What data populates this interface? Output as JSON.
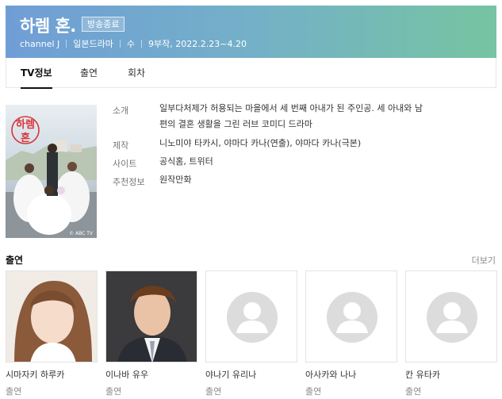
{
  "header": {
    "title": "하렘 혼.",
    "badge": "방송종료",
    "meta": [
      "channel J",
      "일본드라마",
      "수",
      "9부작, 2022.2.23~4.20"
    ]
  },
  "tabs": [
    {
      "label": "TV정보",
      "active": true
    },
    {
      "label": "출연",
      "active": false
    },
    {
      "label": "회차",
      "active": false
    }
  ],
  "poster": {
    "title_text": "하렘혼",
    "watermark": "© ABC TV"
  },
  "info": {
    "synopsis_label": "소개",
    "synopsis_line1": "일부다처제가 허용되는 마을에서 세 번째 아내가 된 주인공. 세 아내와 남",
    "synopsis_line2": "편의 결혼 생활을 그린 러브 코미디 드라마",
    "production_label": "제작",
    "production_value": "니노미야 타카시, 야마다 카나(연출), 야마다 카나(극본)",
    "site_label": "사이트",
    "site_links": [
      "공식홈",
      "트위터"
    ],
    "recommend_label": "추천정보",
    "recommend_value": "원작만화"
  },
  "cast_section": {
    "title": "출연",
    "more": "더보기",
    "members": [
      {
        "name": "시마자키 하루카",
        "role": "출연",
        "photo": "portrait"
      },
      {
        "name": "이나바 유우",
        "role": "출연",
        "photo": "portrait"
      },
      {
        "name": "야나기 유리나",
        "role": "출연",
        "photo": "placeholder"
      },
      {
        "name": "아사카와 나나",
        "role": "출연",
        "photo": "placeholder"
      },
      {
        "name": "칸 유타카",
        "role": "출연",
        "photo": "placeholder"
      }
    ]
  },
  "colors": {
    "hero_start": "#6f9ed6",
    "hero_end": "#76c4a2",
    "poster_title_red": "#d8343a",
    "placeholder_gray": "#d9d9d9"
  }
}
